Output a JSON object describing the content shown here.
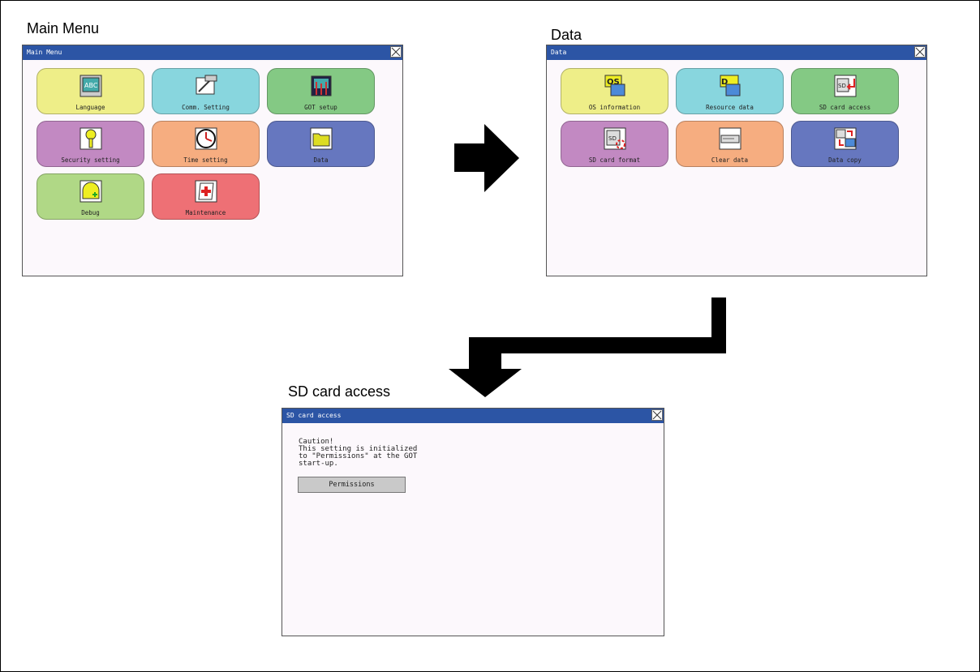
{
  "captions": {
    "main_menu": "Main Menu",
    "data": "Data",
    "sd_card_access": "SD card access"
  },
  "main_menu_window": {
    "title": "Main Menu",
    "tiles": [
      {
        "label": "Language",
        "icon": "language-icon",
        "color": "#eeee88"
      },
      {
        "label": "Comm. Setting",
        "icon": "comm-setting-icon",
        "color": "#88d6de"
      },
      {
        "label": "GOT setup",
        "icon": "got-setup-icon",
        "color": "#84c984"
      },
      {
        "label": "Security setting",
        "icon": "key-icon",
        "color": "#c289c2"
      },
      {
        "label": "Time setting",
        "icon": "clock-icon",
        "color": "#f6ad80"
      },
      {
        "label": "Data",
        "icon": "folder-icon",
        "color": "#6677bf"
      },
      {
        "label": "Debug",
        "icon": "debug-icon",
        "color": "#b0d886"
      },
      {
        "label": "Maintenance",
        "icon": "maintenance-icon",
        "color": "#ee7075"
      }
    ]
  },
  "data_window": {
    "title": "Data",
    "tiles": [
      {
        "label": "OS information",
        "icon": "os-information-icon",
        "color": "#eeee88"
      },
      {
        "label": "Resource data",
        "icon": "resource-data-icon",
        "color": "#88d6de"
      },
      {
        "label": "SD card access",
        "icon": "sd-card-access-icon",
        "color": "#84c984"
      },
      {
        "label": "SD card format",
        "icon": "sd-card-format-icon",
        "color": "#c289c2"
      },
      {
        "label": "Clear data",
        "icon": "clear-data-icon",
        "color": "#f6ad80"
      },
      {
        "label": "Data copy",
        "icon": "data-copy-icon",
        "color": "#6677bf"
      }
    ]
  },
  "sd_window": {
    "title": "SD card access",
    "caution_lines": [
      "Caution!",
      "This setting is initialized",
      "to \"Permissions\" at the GOT",
      "start-up."
    ],
    "permissions_button": "Permissions"
  },
  "colors": {
    "titlebar": "#2c55a5",
    "window_bg": "#fcf8fc",
    "arrow": "#000000"
  }
}
